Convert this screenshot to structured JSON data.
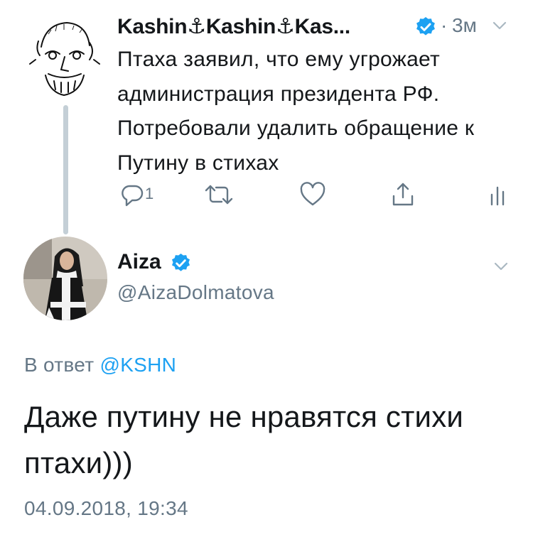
{
  "parent_tweet": {
    "author_name": "Kashin⚓Kashin⚓Kas...",
    "time": "3м",
    "separator": "·",
    "text": "Птаха заявил, что ему угрожает администрация президента РФ. Потребовали удалить обращение к Путину в стихах",
    "reply_count": "1"
  },
  "reply_tweet": {
    "author_name": "Aiza",
    "handle": "@AizaDolmatova",
    "reply_to_label": "В ответ",
    "reply_to_mention": "@KSHN",
    "text": "Даже путину не нравятся стихи птахи)))",
    "date": "04.09.2018, 19:34"
  },
  "colors": {
    "accent": "#1da1f2",
    "secondary_text": "#657786",
    "thread_line": "#c4cfd6"
  }
}
